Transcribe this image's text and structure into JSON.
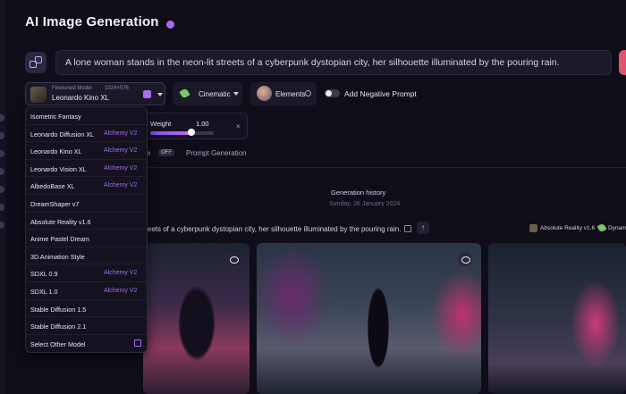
{
  "header": {
    "title": "AI Image Generation"
  },
  "prompt": {
    "value": "A lone woman stands in the neon-lit streets of a cyberpunk dystopian city, her silhouette illuminated by the pouring rain."
  },
  "controls": {
    "model_caption": "Finetuned Model",
    "model_dims": "1024×576",
    "model_name": "Leonardo Kino XL",
    "style": "Cinematic",
    "elements": "Elements",
    "negative_prompt": "Add Negative Prompt"
  },
  "weight": {
    "label": "Weight",
    "value": "1.00",
    "level": 0.65,
    "close": "×"
  },
  "tabs": {
    "partial": "ce",
    "off": "OFF",
    "prompt_generation": "Prompt Generation"
  },
  "history": {
    "title": "Generation history",
    "date": "Sunday, 28 January 2024"
  },
  "generation": {
    "prompt": "treets of a cyberpunk dystopian city, her silhouette illuminated by the pouring rain.",
    "model": "Absolute Reality v1.6",
    "style": "Dynam"
  },
  "dropdown": {
    "items": [
      {
        "name": "Isometric Fantasy",
        "tag": ""
      },
      {
        "name": "Leonardo Diffusion XL",
        "tag": "Alchemy V2"
      },
      {
        "name": "Leonardo Kino XL",
        "tag": "Alchemy V2"
      },
      {
        "name": "Leonardo Vision XL",
        "tag": "Alchemy V2"
      },
      {
        "name": "AlbedoBase XL",
        "tag": "Alchemy V2"
      },
      {
        "name": "DreamShaper v7",
        "tag": ""
      },
      {
        "name": "Absolute Reality v1.6",
        "tag": ""
      },
      {
        "name": "Anime Pastel Dream",
        "tag": ""
      },
      {
        "name": "3D Animation Style",
        "tag": ""
      },
      {
        "name": "SDXL 0.9",
        "tag": "Alchemy V2"
      },
      {
        "name": "SDXL 1.0",
        "tag": "Alchemy V2"
      },
      {
        "name": "Stable Diffusion 1.5",
        "tag": ""
      },
      {
        "name": "Stable Diffusion 2.1",
        "tag": ""
      },
      {
        "name": "Select Other Model",
        "tag": ""
      }
    ]
  },
  "colors": {
    "accent": "#a56cf0",
    "generate": "#e2536d",
    "background": "#0f0d17"
  }
}
